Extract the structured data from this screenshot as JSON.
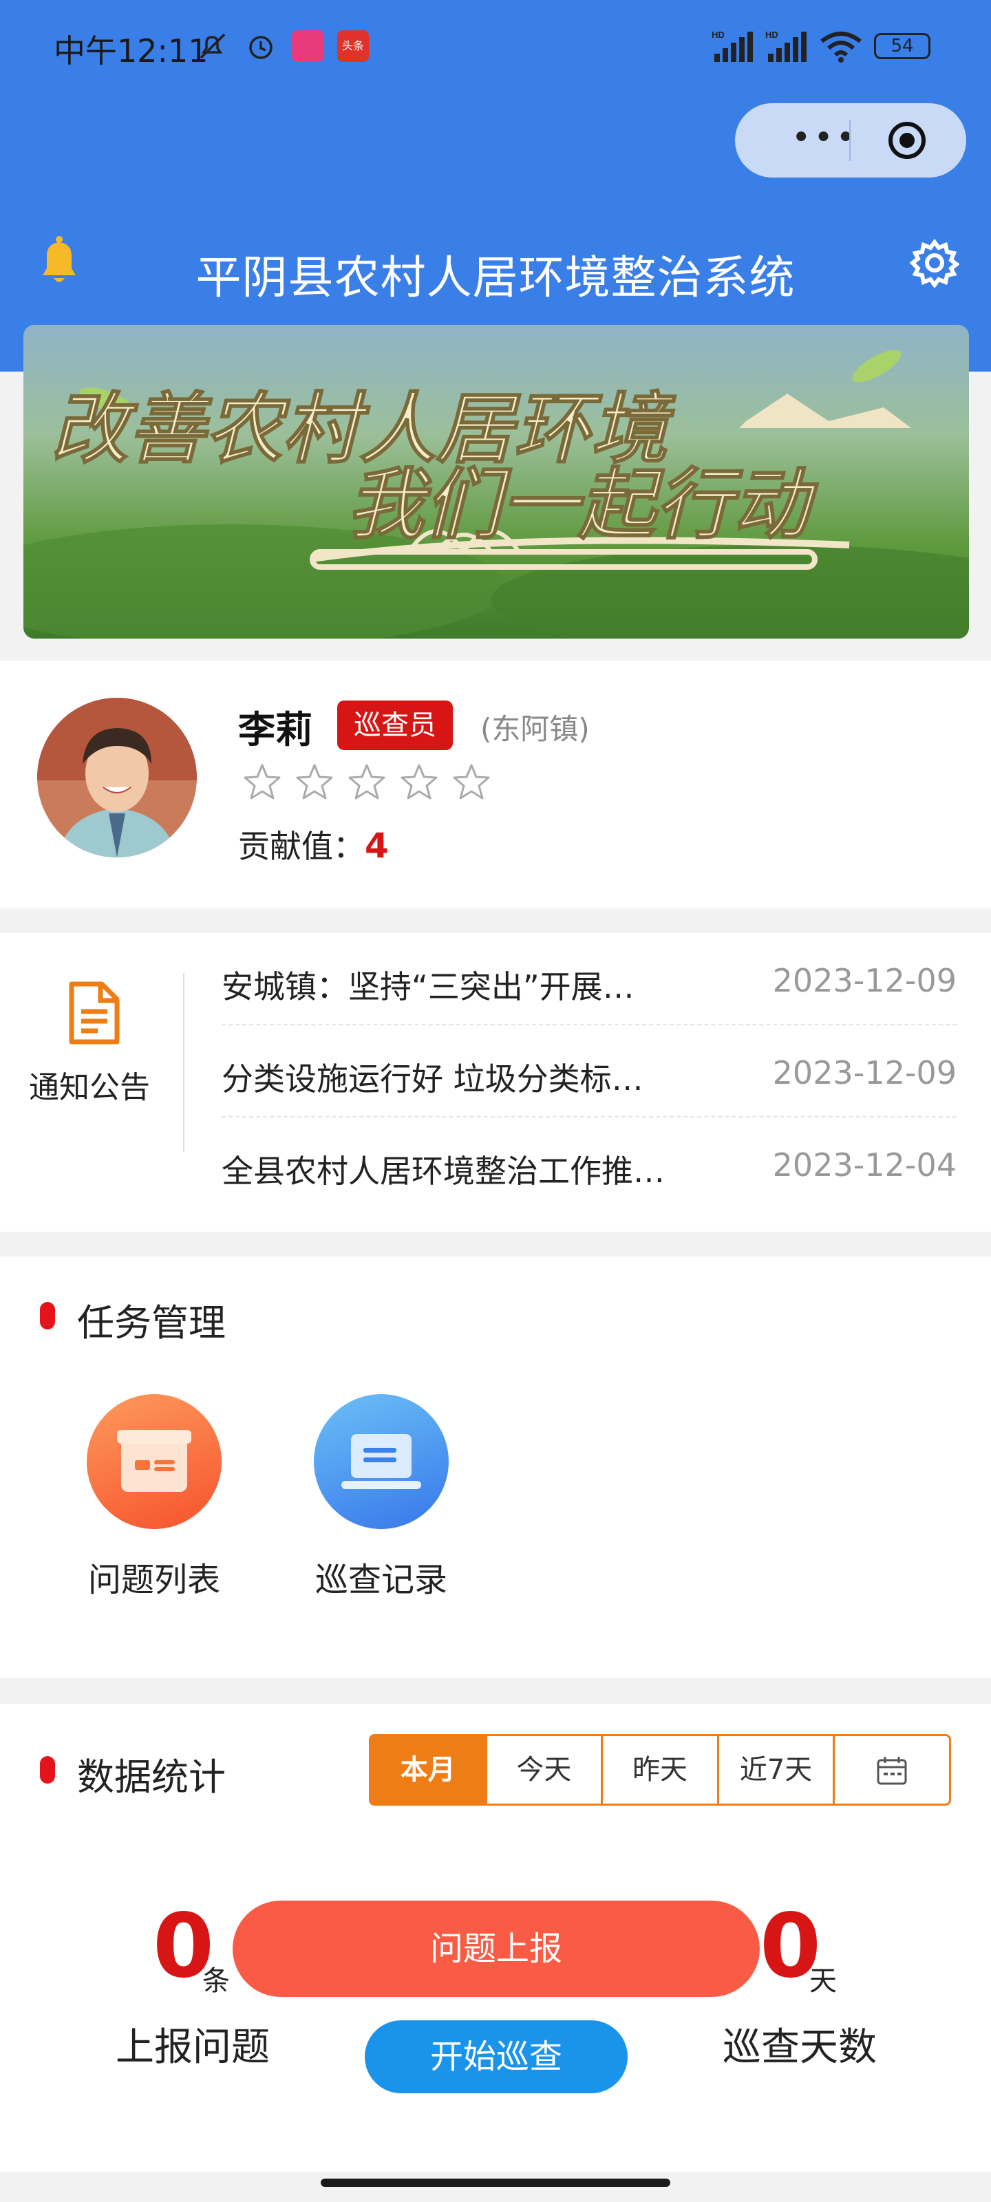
{
  "status_bar": {
    "time": "中午12:11",
    "battery": "54",
    "sim_label": "HD"
  },
  "header": {
    "title": "平阴县农村人居环境整治系统"
  },
  "banner": {
    "line1": "改善农村人居环境",
    "line2": "我们一起行动"
  },
  "profile": {
    "name": "李莉",
    "role": "巡查员",
    "town": "(东阿镇)",
    "rating": 0,
    "rating_max": 5,
    "contribution_label": "贡献值：",
    "contribution_value": "4"
  },
  "notice": {
    "label": "通知公告",
    "items": [
      {
        "title": "安城镇：坚持“三突出”开展…",
        "date": "2023-12-09"
      },
      {
        "title": "分类设施运行好 垃圾分类标…",
        "date": "2023-12-09"
      },
      {
        "title": "全县农村人居环境整治工作推…",
        "date": "2023-12-04"
      }
    ]
  },
  "task": {
    "title": "任务管理",
    "items": [
      {
        "label": "问题列表",
        "icon": "inbox-icon",
        "color": "#f96e35"
      },
      {
        "label": "巡查记录",
        "icon": "laptop-icon",
        "color": "#3d8ef2"
      }
    ]
  },
  "stats": {
    "title": "数据统计",
    "tabs": [
      "本月",
      "今天",
      "昨天",
      "近7天"
    ],
    "active_tab": "本月",
    "reported_value": "0",
    "reported_unit": "条",
    "reported_label": "上报问题",
    "days_value": "0",
    "days_unit": "天",
    "days_label": "巡查天数"
  },
  "actions": {
    "report": "问题上报",
    "start": "开始巡查"
  },
  "colors": {
    "primary_blue": "#3a7ee8",
    "accent_red": "#d81515",
    "orange": "#ef7d16",
    "report_btn": "#fa5b44",
    "start_btn": "#1a93ea"
  }
}
